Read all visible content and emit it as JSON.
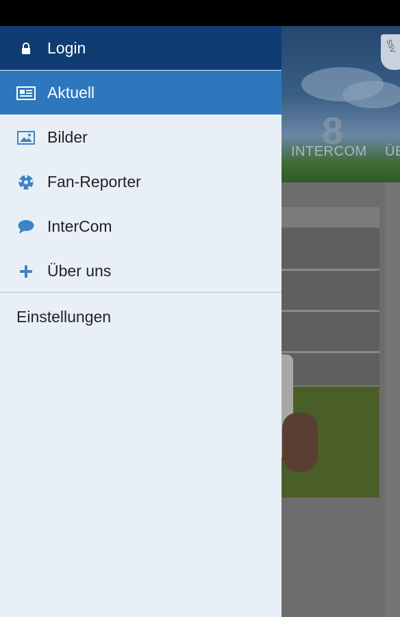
{
  "drawer": {
    "items": [
      {
        "label": "Login",
        "icon": "lock-icon"
      },
      {
        "label": "Aktuell",
        "icon": "newspaper-icon"
      },
      {
        "label": "Bilder",
        "icon": "image-icon"
      },
      {
        "label": "Fan-Reporter",
        "icon": "soccer-ball-icon"
      },
      {
        "label": "InterCom",
        "icon": "chat-bubble-icon"
      },
      {
        "label": "Über uns",
        "icon": "plus-icon"
      }
    ],
    "settings_label": "Einstellungen"
  },
  "background": {
    "tab_intercom": "INTERCOM",
    "tab_ueber": "ÜB",
    "header_number": "8",
    "crest_text": "SSV"
  },
  "colors": {
    "drawer_bg": "#e8eff6",
    "login_bg": "#0e3c73",
    "active_bg": "#2e77bd",
    "icon_blue": "#3d83c6"
  }
}
